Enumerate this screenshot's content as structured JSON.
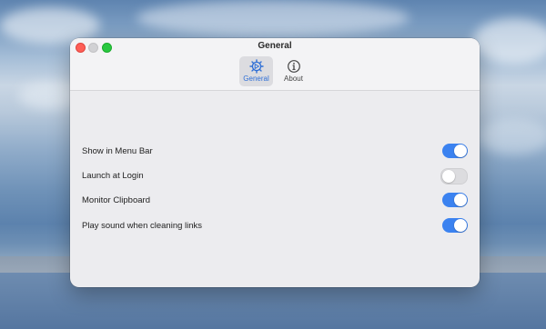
{
  "window": {
    "title": "General"
  },
  "tabs": [
    {
      "label": "General",
      "icon": "gear-icon",
      "selected": true
    },
    {
      "label": "About",
      "icon": "info-icon",
      "selected": false
    }
  ],
  "settings": [
    {
      "label": "Show in Menu Bar",
      "enabled": true
    },
    {
      "label": "Launch at Login",
      "enabled": false
    },
    {
      "label": "Monitor Clipboard",
      "enabled": true
    },
    {
      "label": "Play sound when cleaning links",
      "enabled": true
    }
  ],
  "colors": {
    "accent": "#3b82f0",
    "toggle_off": "#dcdcdf",
    "window_bg": "#ececef"
  }
}
